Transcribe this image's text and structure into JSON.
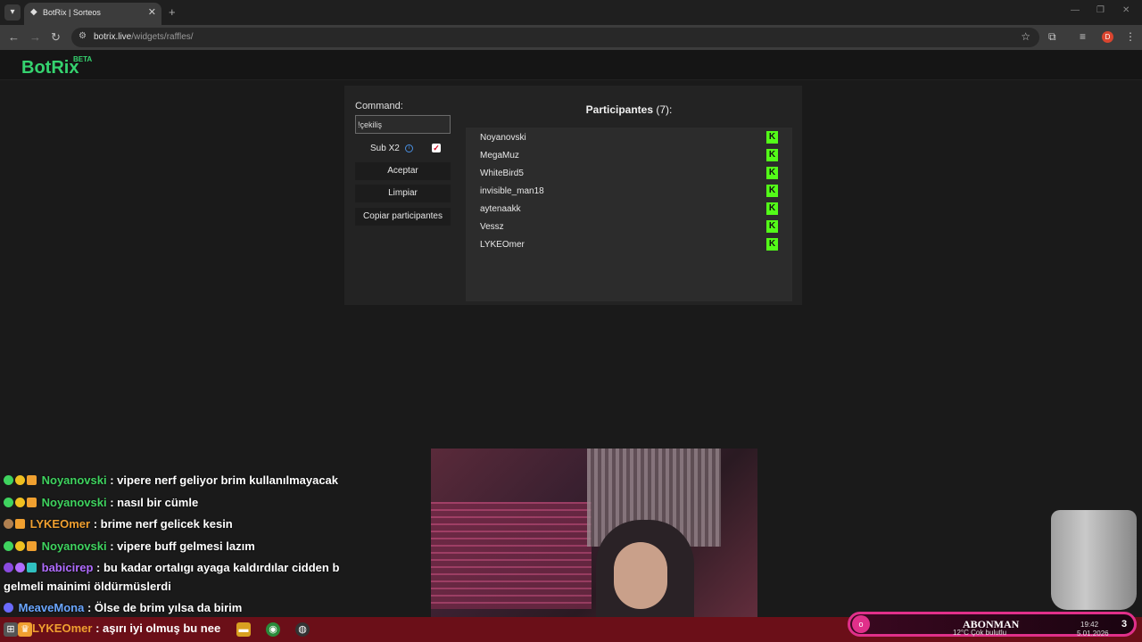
{
  "browser": {
    "tab_title": "BotRix | Sorteos",
    "url_host": "botrix.live",
    "url_path": "/widgets/raffles/",
    "profile_initial": "D"
  },
  "header": {
    "logo": "BotRix",
    "badge": "BETA"
  },
  "raffle": {
    "command_label": "Command:",
    "command_value": "!çekiliş",
    "sub_label": "Sub X2",
    "sub_checked": true,
    "accept_label": "Aceptar",
    "clear_label": "Limpiar",
    "copy_label": "Copiar participantes",
    "participants_title": "Participantes",
    "participants_count": "(7):",
    "participants": [
      "Noyanovski",
      "MegaMuz",
      "WhiteBird5",
      "invisible_man18",
      "aytenaakk",
      "Vessz",
      "LYKEOmer"
    ]
  },
  "chat": {
    "messages": [
      {
        "user": "Noyanovski",
        "text": ": vipere nerf geliyor brim kullanılmayacak"
      },
      {
        "user": "Noyanovski",
        "text": ": nasıl bir cümle"
      },
      {
        "user": "LYKEOmer",
        "text": ": brime nerf gelicek kesin"
      },
      {
        "user": "Noyanovski",
        "text": ": vipere buff gelmesi lazım"
      },
      {
        "user": "babicirep",
        "text": ": bu kadar ortalıgı ayaga kaldırdılar cidden b"
      },
      {
        "user": "",
        "text": "gelmeli mainimi öldürmüslerdi"
      },
      {
        "user": "MeaveMona",
        "text": ": Ölse de brim yılsa da birim"
      },
      {
        "user": "LYKEOmer",
        "text": ": aşırı iyi olmuş bu nee"
      }
    ]
  },
  "overlay": {
    "sub_goal_label": "ABONMAN",
    "sub_goal_count": "3",
    "sub_circle": "o"
  },
  "taskbar": {
    "weather": "12°C  Çok bulutlu",
    "time": "19:42",
    "date": "5.01.2026"
  }
}
